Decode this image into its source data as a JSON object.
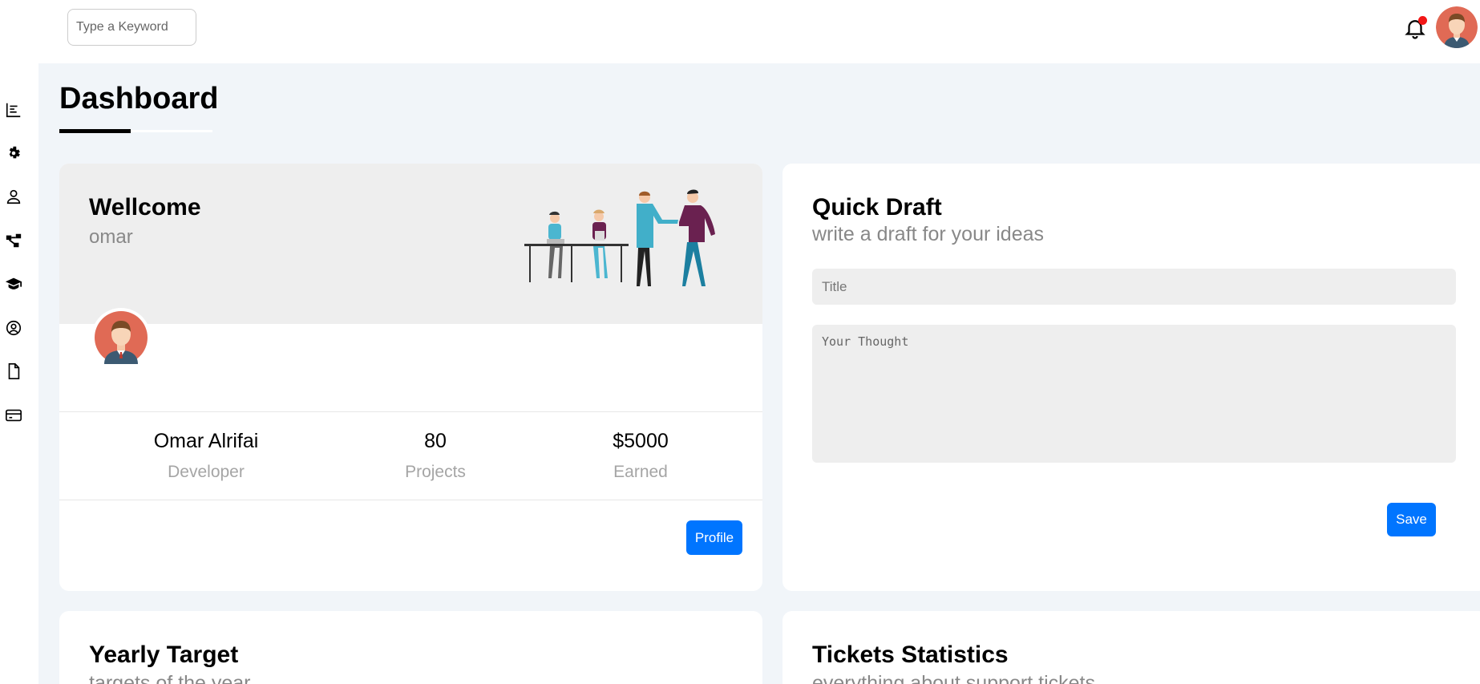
{
  "search": {
    "placeholder": "Type a Keyword"
  },
  "sidebar": {
    "icons": [
      "chart-icon",
      "gear-icon",
      "user-icon",
      "diagram-icon",
      "graduation-cap-icon",
      "user-circle-icon",
      "file-icon",
      "credit-card-icon"
    ]
  },
  "header": {
    "notification_dot_color": "#f21616",
    "page_title": "Dashboard"
  },
  "welcome": {
    "title": "Wellcome",
    "subtitle": "omar",
    "stats": [
      {
        "value": "Omar Alrifai",
        "label": "Developer"
      },
      {
        "value": "80",
        "label": "Projects"
      },
      {
        "value": "$5000",
        "label": "Earned"
      }
    ],
    "profile_button": "Profile"
  },
  "draft": {
    "title": "Quick Draft",
    "subtitle": "write a draft for your ideas",
    "title_placeholder": "Title",
    "thought_placeholder": "Your Thought",
    "save_button": "Save"
  },
  "yearly": {
    "title": "Yearly Target",
    "subtitle": "targets of the year"
  },
  "tickets": {
    "title": "Tickets Statistics",
    "subtitle": "everything about support tickets"
  },
  "colors": {
    "accent": "#0075ff",
    "page_bg": "#f1f5f9",
    "muted": "#888888"
  }
}
